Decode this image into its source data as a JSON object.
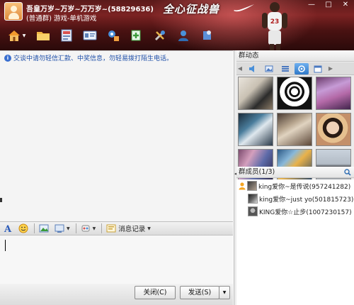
{
  "header": {
    "group_title": "吾皇万岁~万岁~万万岁~(58829636)",
    "group_subtitle": "(普通群) 游戏-单机游戏",
    "slogan": "全心征战兽",
    "window_controls": [
      "—",
      "□",
      "✕"
    ]
  },
  "toolbar": {
    "buttons": [
      "home-icon",
      "folder-icon",
      "album-icon",
      "card-icon",
      "settings-icon",
      "app-icon",
      "tools-icon",
      "user-icon",
      "more-icon"
    ]
  },
  "chat": {
    "notice": "交谈中请勿轻信汇款、中奖信息，勿轻易拨打陌生电话。"
  },
  "format_bar": {
    "history_label": "消息记录"
  },
  "input": {
    "value": "",
    "placeholder": ""
  },
  "actions": {
    "close_label": "关闭(C)",
    "send_label": "发送(S)"
  },
  "feed": {
    "title": "群动态",
    "active_tab": 4
  },
  "members": {
    "title": "群成员",
    "count": "(1/3)",
    "list": [
      {
        "name": "king爱你~是传说(957241282)",
        "owner": true
      },
      {
        "name": "king爱你~just yo(501815723)",
        "owner": false
      },
      {
        "name": "KING爱你☆止步(1007230157)",
        "owner": false
      }
    ]
  },
  "colors": {
    "header_bg": "#5a1a1a",
    "notice_text": "#1d4ea8",
    "active_tab": "#2f78c8"
  }
}
